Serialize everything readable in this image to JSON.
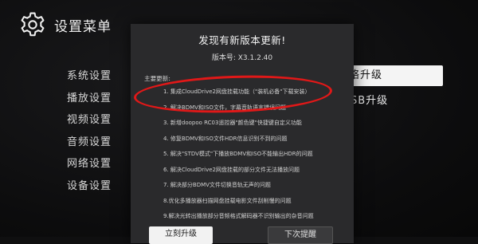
{
  "header": {
    "title": "设置菜单",
    "icon": "gear-icon"
  },
  "menu": {
    "items": [
      {
        "label": "系统设置"
      },
      {
        "label": "播放设置"
      },
      {
        "label": "视频设置"
      },
      {
        "label": "音频设置"
      },
      {
        "label": "网络设置"
      },
      {
        "label": "设备设置"
      }
    ]
  },
  "right_panel": {
    "selected_label": "络升级",
    "second_label": "SB升级"
  },
  "dialog": {
    "title": "发现有新版本更新!",
    "version": "版本号: X3.1.2.40",
    "section_title": "主要更新:",
    "updates": [
      "1. 集成CloudDrive2网盘挂载功能（\"装机必备\"下载安装）",
      "2. 解决BDMV和ISO文件，字幕音轨语言错误问题",
      "3. 新增doopoo RC03遥控器\"颜色键\"快捷键自定义功能",
      "4. 修复BDMV和ISO文件HDR信息识别不到的问题",
      "5. 解决\"STDV模式\"下播放BDMV和ISO不能输出HDR的问题",
      "6. 解决CloudDrive2网盘挂载的部分文件无法播放问题",
      "7. 解决部分BDMV文件切换音轨无声的问题",
      "8.优化多播放器扫描网盘挂载电影文件刮削慢的问题",
      "9.解决光转出播放部分音频格式解码器不识别输出的杂音问题"
    ],
    "buttons": {
      "upgrade": "立刻升级",
      "later": "下次提醒"
    }
  },
  "colors": {
    "highlight": "#e01818",
    "dialog_bg": "#2a2a2c",
    "selected_bg": "#f4f4f4"
  }
}
